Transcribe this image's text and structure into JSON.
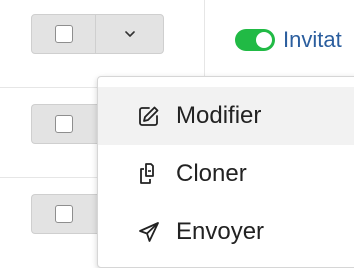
{
  "rows": [
    {
      "checkbox_checked": false
    },
    {
      "checkbox_checked": false
    },
    {
      "checkbox_checked": false
    }
  ],
  "actions_toggle_icon": "chevron-down-icon",
  "status": {
    "enabled": true,
    "label": "Invitat",
    "toggle_color": "#21ba45",
    "label_color": "#2b5e9e"
  },
  "menu": {
    "items": [
      {
        "label": "Modifier",
        "icon": "edit-icon",
        "hovered": true
      },
      {
        "label": "Cloner",
        "icon": "copy-icon",
        "hovered": false
      },
      {
        "label": "Envoyer",
        "icon": "send-icon",
        "hovered": false
      }
    ]
  }
}
